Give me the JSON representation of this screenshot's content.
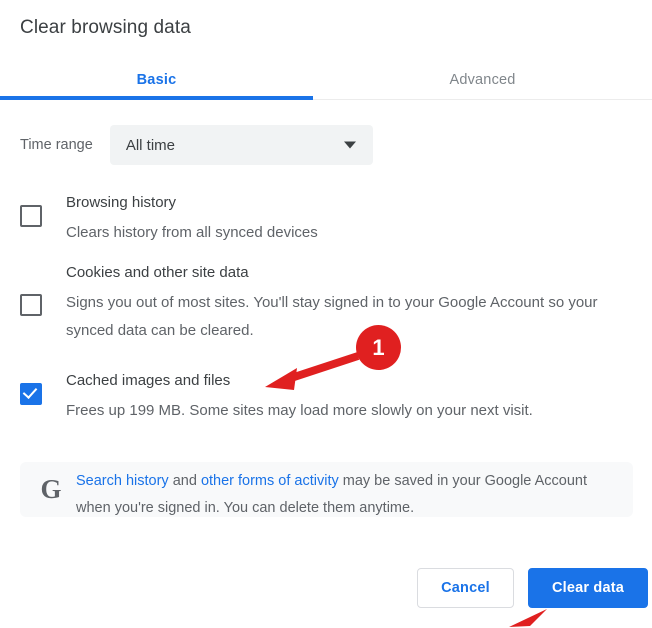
{
  "dialog": {
    "title": "Clear browsing data"
  },
  "tabs": [
    {
      "label": "Basic",
      "selected": true
    },
    {
      "label": "Advanced",
      "selected": false
    }
  ],
  "time_range": {
    "label": "Time range",
    "selected_value": "All time",
    "placeholder": "All time",
    "icon": "chevron-down-icon"
  },
  "options": [
    {
      "title": "Browsing history",
      "description": "Clears history from all synced devices",
      "checked": false
    },
    {
      "title": "Cookies and other site data",
      "description": "Signs you out of most sites. You'll stay signed in to your Google Account so your synced data can be cleared.",
      "checked": false
    },
    {
      "title": "Cached images and files",
      "description": "Frees up 199 MB. Some sites may load more slowly on your next visit.",
      "checked": true
    }
  ],
  "notice": {
    "icon": "google-g-icon",
    "link1": "Search history",
    "mid": " and ",
    "link2": "other forms of activity",
    "tail": " may be saved in your Google Account when you're signed in. You can delete them anytime."
  },
  "buttons": {
    "cancel": "Cancel",
    "confirm": "Clear data"
  },
  "annotations": {
    "step_number": "1"
  },
  "colors": {
    "accent_blue": "#1a73e8",
    "text_primary": "#3c4043",
    "text_secondary": "#5f6368",
    "annotation_red": "#e02020",
    "surface_grey": "#f1f3f4",
    "notice_grey": "#f8f9fa"
  }
}
